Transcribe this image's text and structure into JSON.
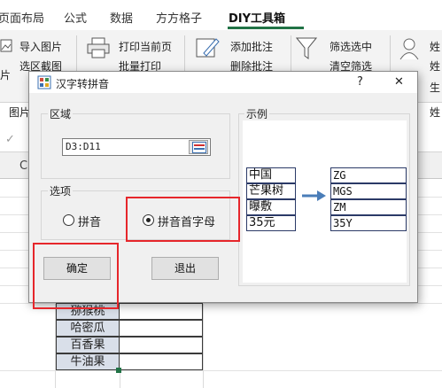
{
  "ribbon": {
    "tabs": [
      {
        "label": "页面布局"
      },
      {
        "label": "公式"
      },
      {
        "label": "数据"
      },
      {
        "label": "方方格子"
      },
      {
        "label": "DIY工具箱"
      }
    ],
    "items": {
      "import_image": "导入图片",
      "region_screenshot": "选区截图",
      "print_current_page": "打印当前页",
      "batch_print": "批量打印",
      "add_comment": "添加批注",
      "delete_comment": "删除批注",
      "filter_select": "筛选选中",
      "clear_filter": "清空筛选",
      "left_image_partial": "片",
      "right_cut_1": "姓",
      "right_cut_2": "姓",
      "right_cut_3": "生"
    },
    "groups": {
      "image": "图片",
      "right_cut": "姓"
    }
  },
  "sheet": {
    "column_c": "C",
    "cells": [
      "猕猴桃",
      "哈密瓜",
      "百香果",
      "牛油果"
    ]
  },
  "dialog": {
    "title": "汉字转拼音",
    "help": "?",
    "close": "✕",
    "region_group": "区域",
    "range_value": "D3:D11",
    "options_group": "选项",
    "option_pinyin": "拼音",
    "option_initials": "拼音首字母",
    "selected_option": "拼音首字母",
    "example_group": "示例",
    "example_input": [
      "中国",
      "芒果树",
      "曝敷",
      "35元"
    ],
    "example_output": [
      "ZG",
      "MGS",
      "ZM",
      "35Y"
    ],
    "ok_button": "确定",
    "exit_button": "退出"
  },
  "colors": {
    "accent": "#217346",
    "highlight": "#e6262b",
    "arrow": "#4a7db8",
    "cell_fill": "#d9dfe9"
  }
}
